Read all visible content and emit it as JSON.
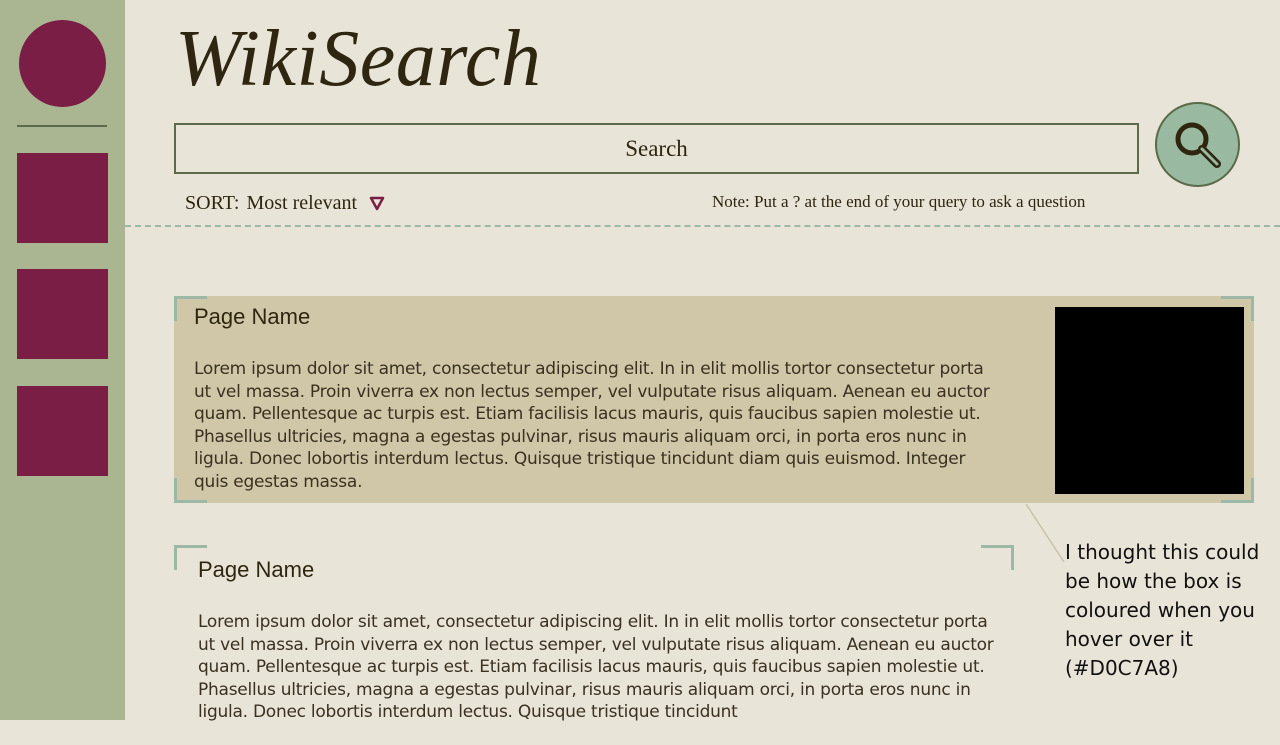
{
  "app": {
    "logo": "WikiSearch"
  },
  "colors": {
    "background": "#E8E4D7",
    "sidebar": "#AAB692",
    "accent": "#7A1E45",
    "search_button": "#99B9A1",
    "card_hover": "#D0C7A8",
    "divider": "#9DB8A7"
  },
  "search": {
    "placeholder": "Search",
    "button_icon": "magnifier-icon"
  },
  "sort": {
    "label": "SORT:",
    "value": "Most relevant",
    "caret_icon": "triangle-down-icon"
  },
  "note": "Note: Put a ? at the end of your query to ask a question",
  "results": [
    {
      "title": "Page Name",
      "snippet": "Lorem ipsum dolor sit amet, consectetur adipiscing elit. In in elit mollis tortor consectetur porta ut vel massa. Proin viverra ex non lectus semper, vel vulputate risus aliquam. Aenean eu auctor quam. Pellentesque ac turpis est. Etiam facilisis lacus mauris, quis faucibus sapien molestie ut. Phasellus ultricies, magna a egestas pulvinar, risus mauris aliquam orci, in porta eros nunc in ligula. Donec lobortis interdum lectus. Quisque tristique tincidunt diam quis euismod. Integer quis egestas massa."
    },
    {
      "title": "Page Name",
      "snippet": "Lorem ipsum dolor sit amet, consectetur adipiscing elit. In in elit mollis tortor consectetur porta ut vel massa. Proin viverra ex non lectus semper, vel vulputate risus aliquam. Aenean eu auctor quam. Pellentesque ac turpis est. Etiam facilisis lacus mauris, quis faucibus sapien molestie ut. Phasellus ultricies, magna a egestas pulvinar, risus mauris aliquam orci, in porta eros nunc in ligula. Donec lobortis interdum lectus. Quisque tristique tincidunt"
    }
  ],
  "callout": "I thought this could be how the box is coloured when you hover over it (#D0C7A8)"
}
